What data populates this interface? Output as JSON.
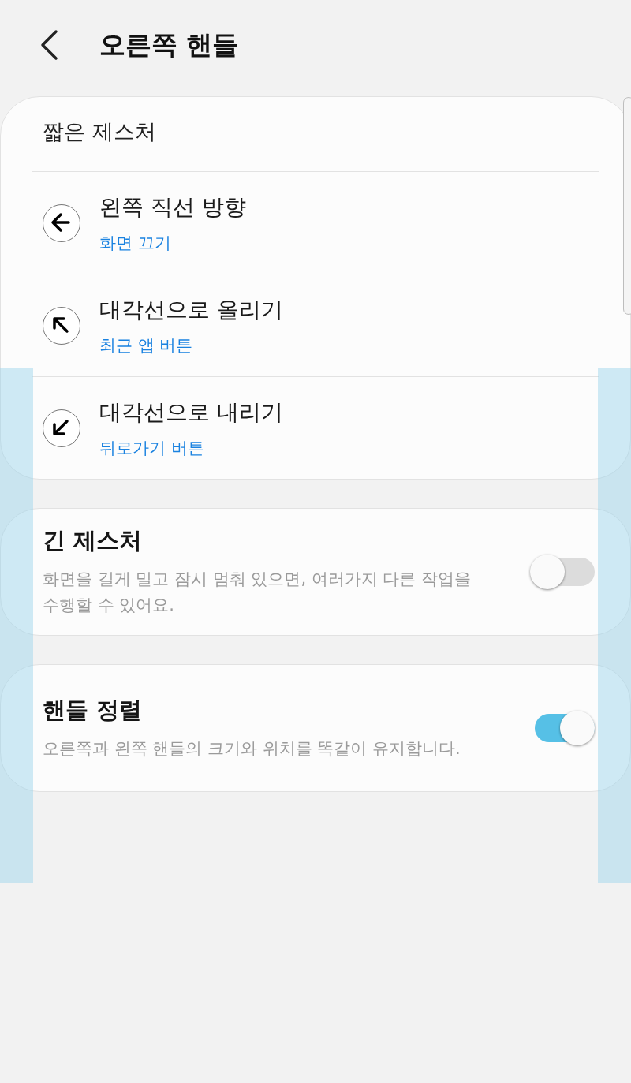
{
  "header": {
    "title": "오른쪽 핸들"
  },
  "short_gestures": {
    "heading": "짧은 제스처",
    "items": [
      {
        "kind": "left",
        "title": "왼쪽 직선 방향",
        "action": "화면 끄기"
      },
      {
        "kind": "up-left",
        "title": "대각선으로 올리기",
        "action": "최근 앱 버튼"
      },
      {
        "kind": "down-left",
        "title": "대각선으로 내리기",
        "action": "뒤로가기 버튼"
      }
    ]
  },
  "settings": [
    {
      "title": "긴 제스처",
      "description": "화면을 길게 밀고 잠시 멈춰 있으면, 여러가지 다른 작업을 수행할 수 있어요.",
      "on": false
    },
    {
      "title": "핸들 정렬",
      "description": "오른쪽과 왼쪽 핸들의 크기와 위치를 똑같이 유지합니다.",
      "on": true
    }
  ]
}
